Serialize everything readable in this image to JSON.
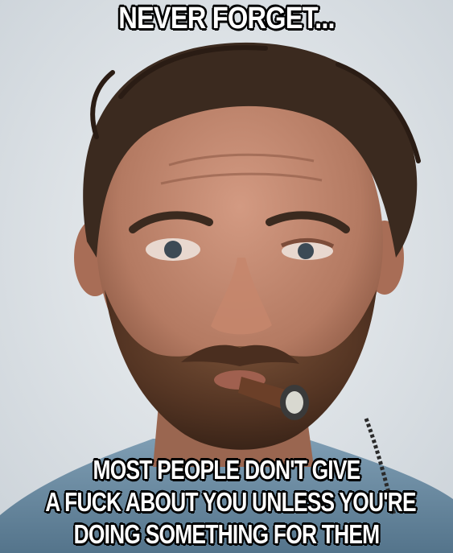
{
  "meme": {
    "top_text": "NEVER FORGET...",
    "bottom_lines": [
      "MOST PEOPLE DON'T GIVE",
      "A FUCK ABOUT YOU UNLESS YOU'RE",
      "DOING SOMETHING FOR THEM"
    ]
  },
  "colors": {
    "background": "#dfe4e8",
    "caption_fill": "#ffffff",
    "caption_outline": "#000000",
    "skin": "#b98068",
    "hair": "#3b2a1f",
    "beard": "#5a3a28",
    "shirt": "#6f8fa6"
  }
}
